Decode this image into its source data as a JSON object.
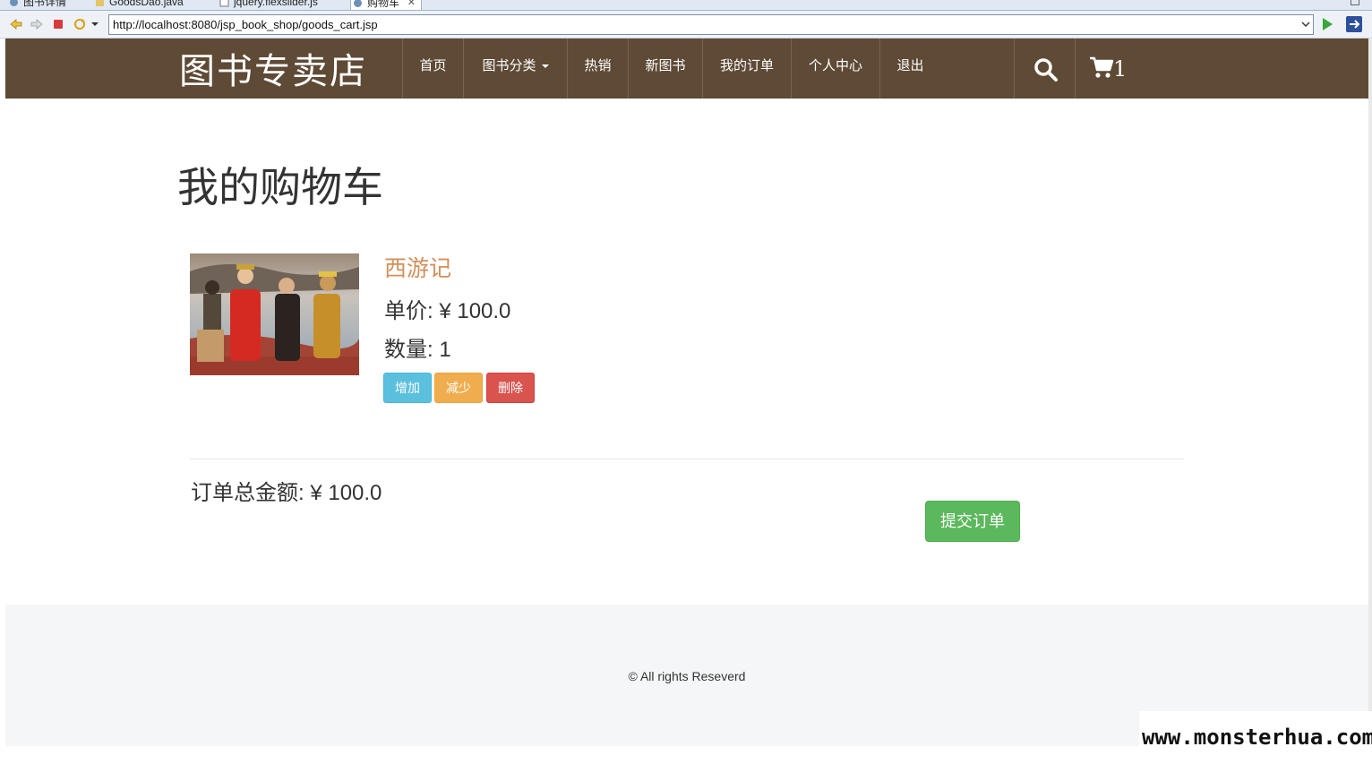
{
  "browser": {
    "tabs": [
      {
        "label": "图书详情",
        "active": false
      },
      {
        "label": "GoodsDao.java",
        "active": false
      },
      {
        "label": "jquery.flexslider.js",
        "active": false
      },
      {
        "label": "购物车",
        "active": true
      }
    ],
    "url": "http://localhost:8080/jsp_book_shop/goods_cart.jsp"
  },
  "navbar": {
    "brand": "图书专卖店",
    "items": [
      {
        "label": "首页"
      },
      {
        "label": "图书分类",
        "has_dropdown": true
      },
      {
        "label": "热销"
      },
      {
        "label": "新图书"
      },
      {
        "label": "我的订单"
      },
      {
        "label": "个人中心"
      },
      {
        "label": "退出"
      }
    ],
    "cart_count": "1",
    "colors": {
      "background": "#5e4a35",
      "text": "#ffffff"
    }
  },
  "cart": {
    "title": "我的购物车",
    "items": [
      {
        "name": "西游记",
        "price_label": "单价: ¥ 100.0",
        "quantity_label": "数量: 1",
        "buttons": {
          "add": "增加",
          "reduce": "减少",
          "delete": "删除"
        }
      }
    ],
    "total_label": "订单总金额: ¥ 100.0",
    "submit_label": "提交订单"
  },
  "footer": {
    "copyright": "© All rights Reseverd"
  },
  "watermark": "www.monsterhua.com",
  "colors": {
    "product_name": "#d2905a",
    "btn_info": "#5bc0de",
    "btn_warning": "#f0ad4e",
    "btn_danger": "#d9534f",
    "btn_success": "#5cb85c",
    "footer_bg": "#f5f6f7"
  }
}
